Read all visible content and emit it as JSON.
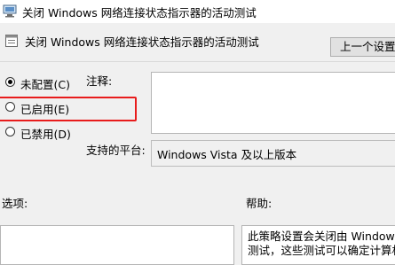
{
  "window": {
    "title": "关闭 Windows 网络连接状态指示器的活动测试"
  },
  "header": {
    "policy_title": "关闭 Windows 网络连接状态指示器的活动测试",
    "prev_button": "上一个设置"
  },
  "state_options": [
    {
      "label": "未配置(C)",
      "checked": true
    },
    {
      "label": "已启用(E)",
      "checked": false
    },
    {
      "label": "已禁用(D)",
      "checked": false
    }
  ],
  "comment": {
    "label": "注释:",
    "value": ""
  },
  "platform": {
    "label": "支持的平台:",
    "value": "Windows Vista 及以上版本"
  },
  "options": {
    "label": "选项:"
  },
  "help": {
    "label": "帮助:",
    "lines": [
      "此策略设置会关闭由 Windows",
      "测试，这些测试可以确定计算机"
    ]
  },
  "colors": {
    "highlight": "#e81c1c",
    "window_bg": "#f0f0f0"
  }
}
